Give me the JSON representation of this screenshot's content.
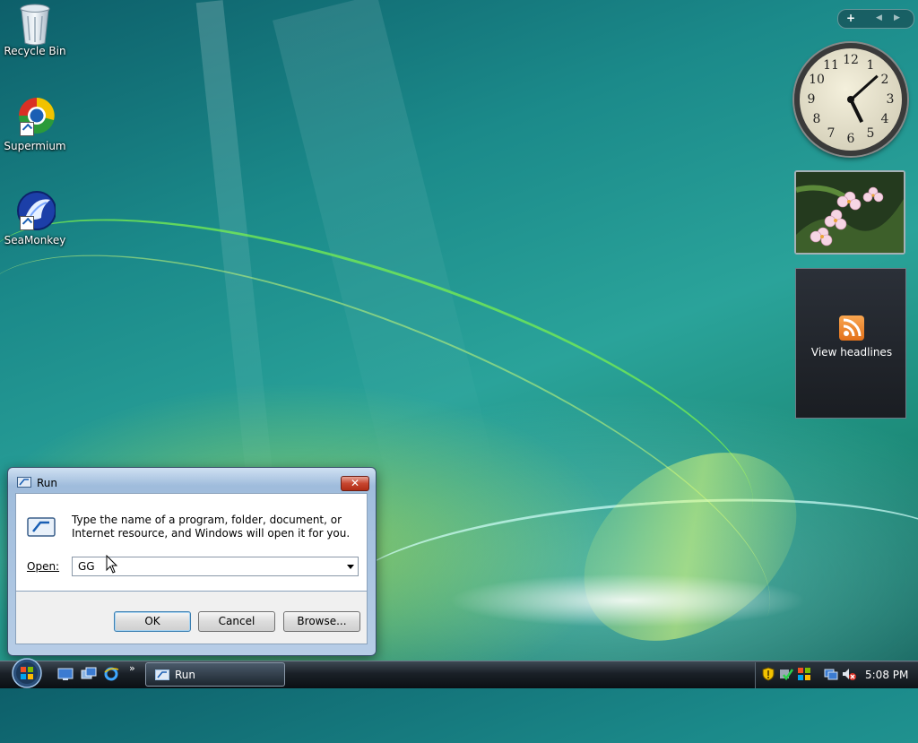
{
  "desktop": {
    "icons": [
      {
        "label": "Recycle Bin",
        "icon": "recycle-bin-icon"
      },
      {
        "label": "Supermium",
        "icon": "supermium-browser-icon"
      },
      {
        "label": "SeaMonkey",
        "icon": "seamonkey-icon"
      }
    ]
  },
  "gadgets": {
    "controls": {
      "add": "+",
      "prev": "◀",
      "next": "▶"
    },
    "clock": {
      "numbers": [
        "12",
        "1",
        "2",
        "3",
        "4",
        "5",
        "6",
        "7",
        "8",
        "9",
        "10",
        "11"
      ],
      "time_shown": "5:08"
    },
    "feed": {
      "label": "View headlines"
    }
  },
  "dialog": {
    "title": "Run",
    "close_glyph": "✕",
    "description": "Type the name of a program, folder, document, or Internet resource, and Windows will open it for you.",
    "open_label": "Open:",
    "open_value": "GG",
    "buttons": {
      "ok": "OK",
      "cancel": "Cancel",
      "browse": "Browse..."
    }
  },
  "taskbar": {
    "chevron": "»",
    "active_task": "Run",
    "clock": "5:08 PM"
  },
  "colors": {
    "taskbar": "#1a2027",
    "dialog_frame": "#9fbcdc",
    "close_button": "#c7462f",
    "accent_green": "#78f050"
  }
}
